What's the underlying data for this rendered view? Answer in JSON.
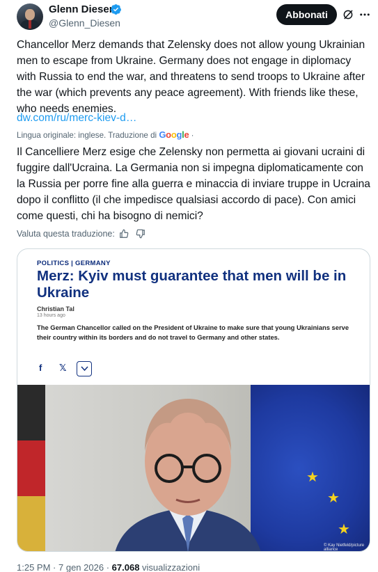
{
  "author": {
    "name": "Glenn Diesen",
    "handle": "@Glenn_Diesen"
  },
  "follow_button": "Abbonati",
  "post": {
    "text": "Chancellor Merz demands that Zelensky does not allow young Ukrainian men to escape from Ukraine. Germany does not engage in diplomacy with Russia to end the war, and threatens to send troops to Ukraine after the war (which prevents any peace agreement). With friends like these, who needs enemies.",
    "link": "dw.com/ru/merc-kiev-d…",
    "translation_note": "Lingua originale: inglese. Traduzione di",
    "translation_provider": "Google",
    "translation_suffix": "·",
    "translated_text": "Il Cancelliere Merz esige che Zelensky non permetta ai giovani ucraini di fuggire dall'Ucraina. La Germania non si impegna diplomaticamente con la Russia per porre fine alla guerra e minaccia di inviare truppe in Ucraina dopo il conflitto (il che impedisce qualsiasi accordo di pace). Con amici come questi, chi ha bisogno di nemici?",
    "rate_label": "Valuta questa traduzione:"
  },
  "card": {
    "kicker": "POLITICS | GERMANY",
    "headline": "Merz: Kyiv must guarantee that men will be in Ukraine",
    "author": "Christian Tal",
    "time_ago": "13 hours ago",
    "lede": "The German Chancellor called on the President of Ukraine to make sure that young Ukrainians serve their country within its borders and do not travel to Germany and other states.",
    "share_fb": "f",
    "share_x": "𝕏",
    "photo_credit": "© Kay Nietfeld/picture alliance"
  },
  "footer": {
    "time": "1:25 PM",
    "date": "7 gen 2026",
    "views_count": "67.068",
    "views_label": "visualizzazioni"
  },
  "colors": {
    "link": "#1d9bf0",
    "secondary": "#536471",
    "headline": "#11317f",
    "verified": "#1d9bf0"
  }
}
